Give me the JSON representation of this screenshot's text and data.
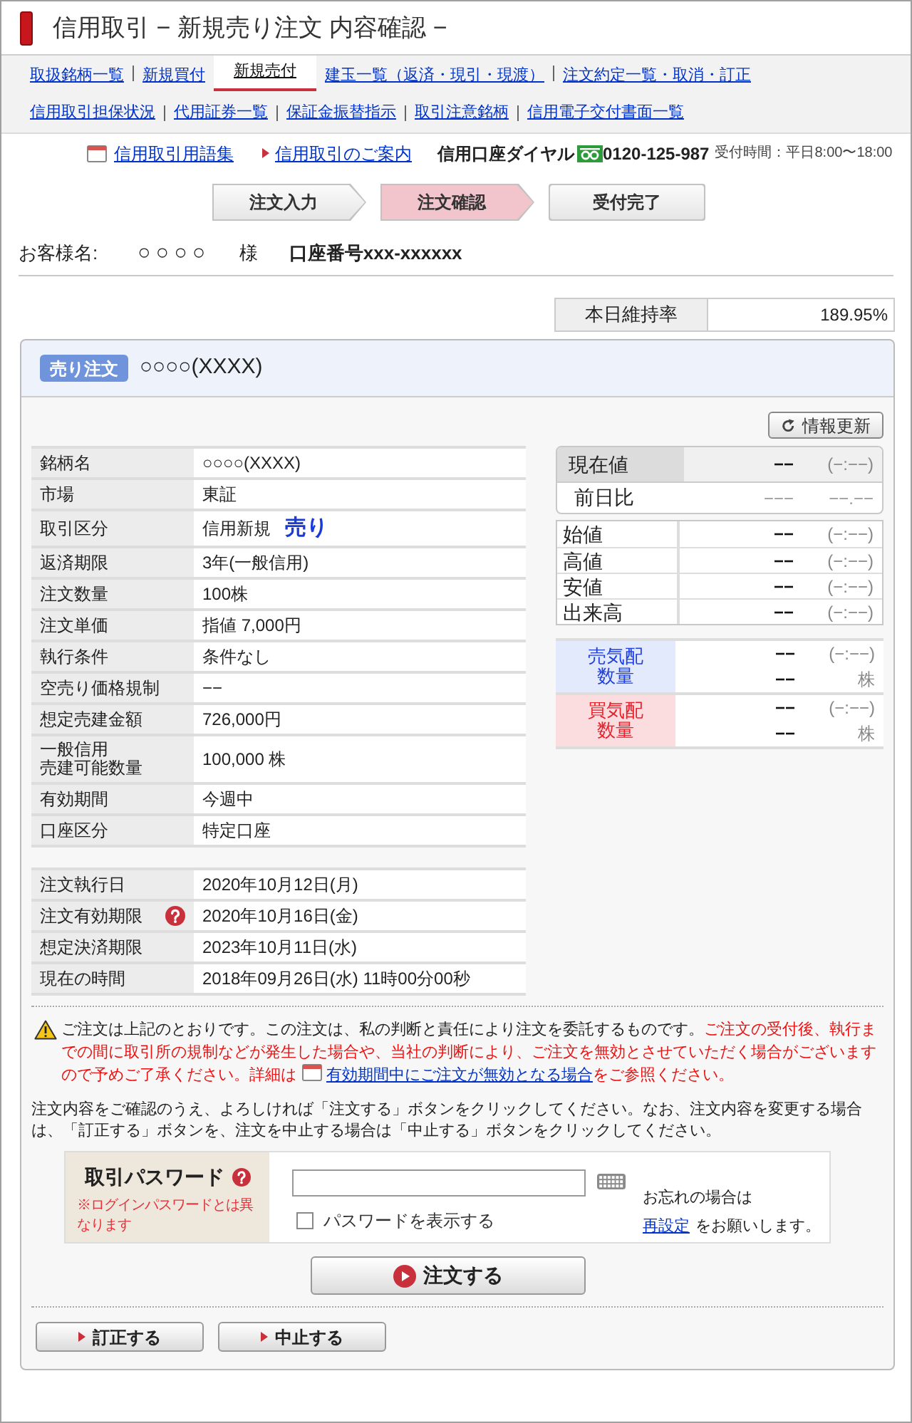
{
  "header": {
    "title": "信用取引 − 新規売り注文 内容確認 −"
  },
  "nav_tabs": [
    {
      "label": "取扱銘柄一覧",
      "selected": false
    },
    {
      "label": "新規買付",
      "selected": false
    },
    {
      "label": "新規売付",
      "selected": true
    },
    {
      "label": "建玉一覧（返済・現引・現渡）",
      "selected": false
    },
    {
      "label": "注文約定一覧・取消・訂正",
      "selected": false
    }
  ],
  "nav_links": [
    "信用取引担保状況",
    "代用証券一覧",
    "保証金振替指示",
    "取引注意銘柄",
    "信用電子交付書面一覧"
  ],
  "help_links": [
    {
      "kind": "glossary",
      "label": "信用取引用語集"
    },
    {
      "kind": "guide",
      "label": "信用取引のご案内"
    }
  ],
  "hotline": {
    "label": "信用口座ダイヤル",
    "number": "0120-125-987",
    "hours": "受付時間：平日8:00〜18:00"
  },
  "steps": [
    {
      "label": "注文入力",
      "selected": false
    },
    {
      "label": "注文確認",
      "selected": true
    },
    {
      "label": "受付完了",
      "selected": false
    }
  ],
  "customer": {
    "name_label": "お客様名:",
    "name": "○○○○",
    "honorific": "様",
    "account": "口座番号xxx-xxxxxx"
  },
  "maintenance_ratio": {
    "label": "本日維持率",
    "value": "189.95%"
  },
  "order": {
    "badge": "売り注文",
    "title": "○○○○(XXXX)",
    "refresh_button": "情報更新",
    "details": [
      {
        "label": "銘柄名",
        "value": "○○○○(XXXX)"
      },
      {
        "label": "市場",
        "value": "東証"
      },
      {
        "label": "取引区分",
        "value": "信用新規",
        "side": "売り"
      },
      {
        "label": "返済期限",
        "value": "3年(一般信用)"
      },
      {
        "label": "注文数量",
        "value": "100株"
      },
      {
        "label": "注文単価",
        "value": "指値 7,000円"
      },
      {
        "label": "執行条件",
        "value": "条件なし"
      },
      {
        "label": "空売り価格規制",
        "value": "−−"
      },
      {
        "label": "想定売建金額",
        "value": "726,000円"
      },
      {
        "label": "一般信用",
        "label_line2": "売建可能数量",
        "value": "100,000 株"
      },
      {
        "label": "有効期間",
        "value": "今週中"
      },
      {
        "label": "口座区分",
        "value": "特定口座"
      }
    ],
    "dates": [
      {
        "label": "注文執行日",
        "value": "2020年10月12日(月)",
        "help": false
      },
      {
        "label": "注文有効期限",
        "value": "2020年10月16日(金)",
        "help": true
      },
      {
        "label": "想定決済期限",
        "value": "2023年10月11日(水)",
        "help": false
      },
      {
        "label": "現在の時間",
        "value": "2018年09月26日(水) 11時00分00秒",
        "help": false
      }
    ],
    "quote": {
      "current": {
        "label": "現在値",
        "price": "−−",
        "time": "(−:−−)"
      },
      "change": {
        "label": "前日比",
        "value": "−−−",
        "percent": "−−.−−"
      },
      "prices": [
        {
          "label": "始値",
          "price": "−−",
          "time": "(−:−−)"
        },
        {
          "label": "高値",
          "price": "−−",
          "time": "(−:−−)"
        },
        {
          "label": "安値",
          "price": "−−",
          "time": "(−:−−)"
        },
        {
          "label": "出来高",
          "price": "−−",
          "time": "(−:−−)"
        }
      ],
      "book": [
        {
          "kind": "sell",
          "label": "売気配数量",
          "price": "−−",
          "time": "(−:−−)",
          "quantity": "−−",
          "unit": "株"
        },
        {
          "kind": "buy",
          "label": "買気配数量",
          "price": "−−",
          "time": "(−:−−)",
          "quantity": "−−",
          "unit": "株"
        }
      ]
    }
  },
  "notice": {
    "text": "ご注文は上記のとおりです。この注文は、私の判断と責任により注文を委託するものです。",
    "warning": "ご注文の受付後、執行までの間に取引所の規制などが発生した場合や、当社の判断により、ご注文を無効とさせていただく場合がございますので予めご了承ください。詳細は",
    "link": "有効期間中にご注文が無効となる場合",
    "suffix": "をご参照ください。"
  },
  "instructions": "注文内容をご確認のうえ、よろしければ「注文する」ボタンをクリックしてください。なお、注文内容を変更する場合は、「訂正する」ボタンを、注文を中止する場合は「中止する」ボタンをクリックしてください。",
  "password": {
    "label": "取引パスワード",
    "note": "※ログインパスワードとは異なります",
    "show_password": {
      "label": "パスワードを表示する",
      "checked": false
    },
    "forgot": "お忘れの場合は",
    "reset_link": "再設定",
    "reset_suffix": "をお願いします。"
  },
  "submit_button": "注文する",
  "buttons": [
    "訂正する",
    "中止する"
  ]
}
